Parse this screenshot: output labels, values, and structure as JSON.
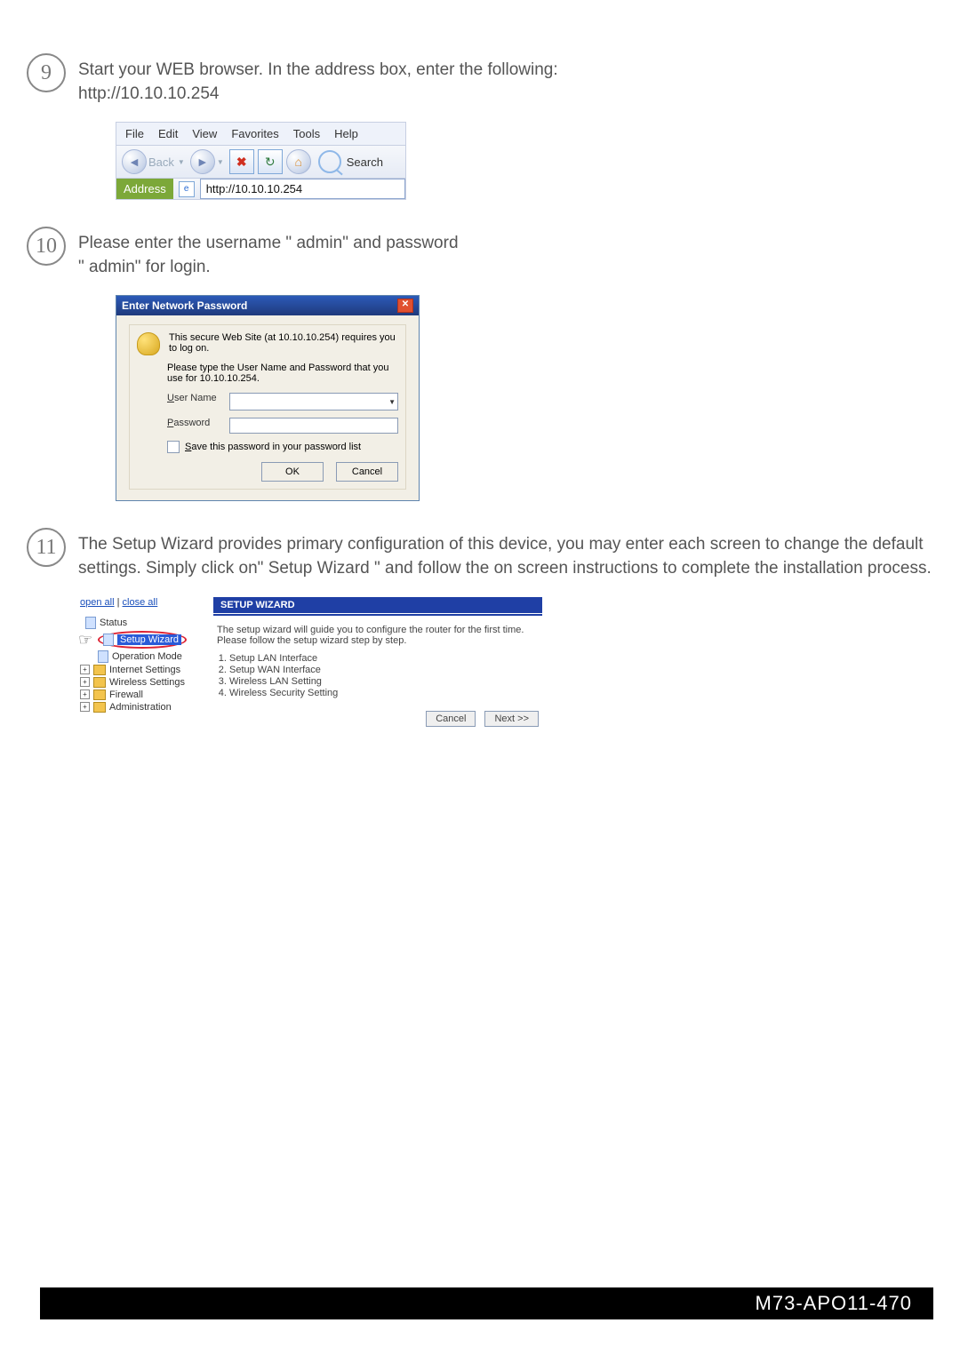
{
  "steps": {
    "s9": {
      "num": "9",
      "text": "Start your WEB browser. In the address box, enter the following:\nhttp://10.10.10.254"
    },
    "s10": {
      "num": "10",
      "text": "Please enter the username \" admin\"   and password\n\" admin\"   for login."
    },
    "s11": {
      "num": "11",
      "text": "The Setup Wizard provides primary configuration of this device, you may enter each screen to change the default settings. Simply click on\"   Setup Wizard \"   and follow the on screen instructions to complete the installation process."
    }
  },
  "browser": {
    "menus": [
      "File",
      "Edit",
      "View",
      "Favorites",
      "Tools",
      "Help"
    ],
    "back": "Back",
    "search": "Search",
    "address_label": "Address",
    "address_value": "http://10.10.10.254"
  },
  "pw": {
    "title": "Enter Network Password",
    "line1": "This secure Web Site (at 10.10.10.254) requires you to log on.",
    "line2": "Please type the User Name and Password that you use for 10.10.10.254.",
    "user_label": "User Name",
    "pass_label": "Password",
    "save_label": "Save this password in your password list",
    "ok": "OK",
    "cancel": "Cancel"
  },
  "wiz": {
    "open": "open all",
    "close": "close all",
    "tree": {
      "status": "Status",
      "setup": "Setup Wizard",
      "opmode": "Operation Mode",
      "inet": "Internet Settings",
      "wless": "Wireless Settings",
      "fw": "Firewall",
      "admin": "Administration"
    },
    "title": "SETUP WIZARD",
    "intro": "The setup wizard will guide you to configure the router for the first time. Please follow the setup wizard step by step.",
    "steps": [
      "Setup LAN Interface",
      "Setup WAN Interface",
      "Wireless LAN Setting",
      "Wireless Security Setting"
    ],
    "cancel": "Cancel",
    "next": "Next >>"
  },
  "footer": "M73-APO11-470"
}
